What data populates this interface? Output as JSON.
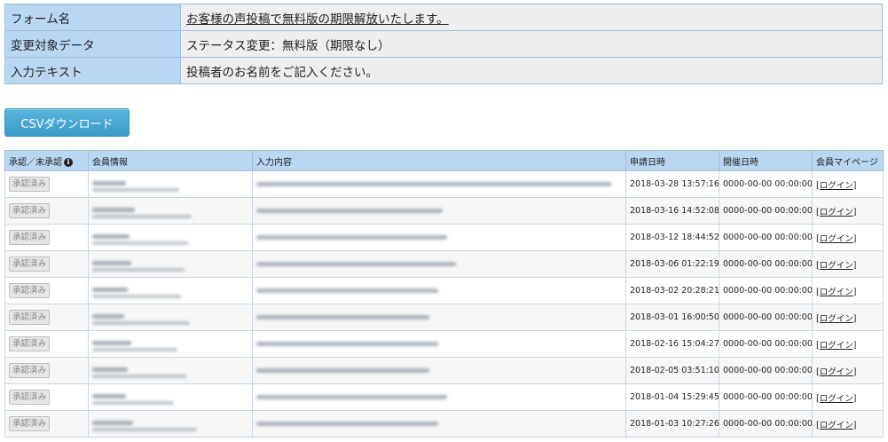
{
  "info": {
    "rows": [
      {
        "label": "フォーム名",
        "value": "お客様の声投稿で無料版の期限解放いたします。",
        "link": true
      },
      {
        "label": "変更対象データ",
        "value": "ステータス変更：無料版（期限なし）",
        "link": false
      },
      {
        "label": "入力テキスト",
        "value": "投稿者のお名前をご記入ください。",
        "link": false
      }
    ]
  },
  "csv_button": "CSVダウンロード",
  "table": {
    "headers": {
      "approval": "承認／未承認",
      "member": "会員情報",
      "content": "入力内容",
      "applied": "申請日時",
      "held": "開催日時",
      "mypage": "会員マイページ"
    },
    "rows": [
      {
        "status": "承認済み",
        "applied": "2018-03-28 13:57:16",
        "held": "0000-00-00 00:00:00",
        "login": "[ログイン]"
      },
      {
        "status": "承認済み",
        "applied": "2018-03-16 14:52:08",
        "held": "0000-00-00 00:00:00",
        "login": "[ログイン]"
      },
      {
        "status": "承認済み",
        "applied": "2018-03-12 18:44:52",
        "held": "0000-00-00 00:00:00",
        "login": "[ログイン]"
      },
      {
        "status": "承認済み",
        "applied": "2018-03-06 01:22:19",
        "held": "0000-00-00 00:00:00",
        "login": "[ログイン]"
      },
      {
        "status": "承認済み",
        "applied": "2018-03-02 20:28:21",
        "held": "0000-00-00 00:00:00",
        "login": "[ログイン]"
      },
      {
        "status": "承認済み",
        "applied": "2018-03-01 16:00:50",
        "held": "0000-00-00 00:00:00",
        "login": "[ログイン]"
      },
      {
        "status": "承認済み",
        "applied": "2018-02-16 15:04:27",
        "held": "0000-00-00 00:00:00",
        "login": "[ログイン]"
      },
      {
        "status": "承認済み",
        "applied": "2018-02-05 03:51:10",
        "held": "0000-00-00 00:00:00",
        "login": "[ログイン]"
      },
      {
        "status": "承認済み",
        "applied": "2018-01-04 15:29:45",
        "held": "0000-00-00 00:00:00",
        "login": "[ログイン]"
      },
      {
        "status": "承認済み",
        "applied": "2018-01-03 10:27:26",
        "held": "0000-00-00 00:00:00",
        "login": "[ログイン]"
      }
    ]
  }
}
